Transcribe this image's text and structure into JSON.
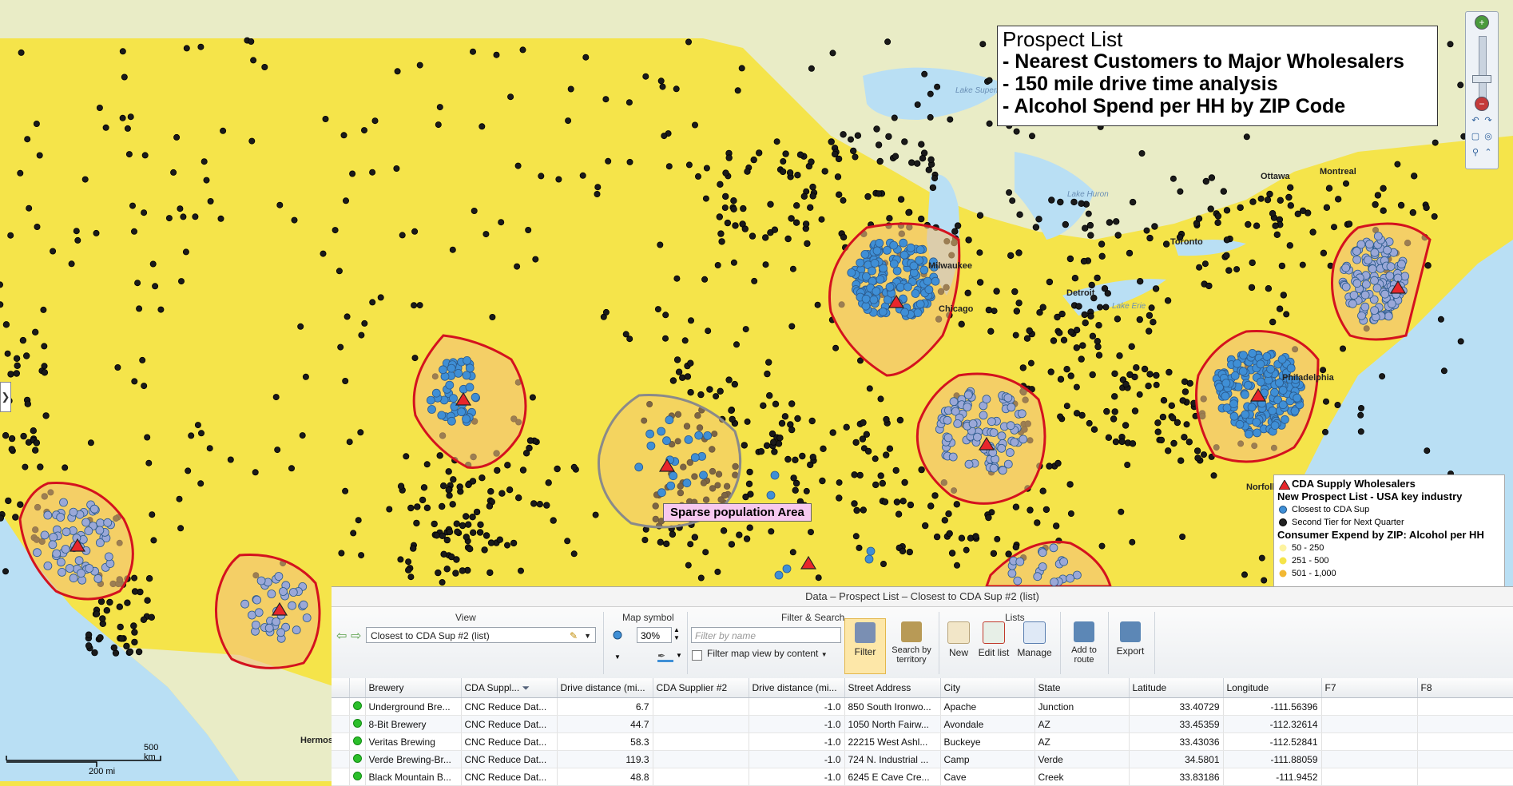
{
  "title_box": {
    "line1": "Prospect List",
    "line2": "- Nearest Customers to Major Wholesalers",
    "line3": "- 150 mile drive time analysis",
    "line4": "-  Alcohol Spend per HH by ZIP Code"
  },
  "map_labels": {
    "lake_superior": "Lake Superior",
    "lake_huron": "Lake Huron",
    "lake_erie": "Lake Erie",
    "ottawa": "Ottawa",
    "montreal": "Montreal",
    "milwaukee": "Milwaukee",
    "chicago": "Chicago",
    "detroit": "Detroit",
    "toronto": "Toronto",
    "philadelphia": "Philadelphia",
    "norfolk": "Norfolk",
    "hermosillo": "Hermos"
  },
  "callout": "Sparse population Area",
  "legend": {
    "wholesalers": "CDA Supply Wholesalers",
    "prospect_header": "New Prospect List - USA key industry",
    "closest": "Closest to CDA Sup",
    "second_tier": "Second Tier for Next Quarter",
    "consumer_header": "Consumer Expend by ZIP: Alcohol per HH",
    "range1": "50 - 250",
    "range2": "251 - 500",
    "range3": "501 - 1,000"
  },
  "scale": {
    "km": "500 km",
    "mi": "200 mi"
  },
  "panel": {
    "title": "Data – Prospect List – Closest to CDA Sup #2 (list)",
    "view_label": "View",
    "view_value": "Closest to CDA Sup #2 (list)",
    "map_symbol_label": "Map symbol",
    "percent": "30%",
    "filter_search_label": "Filter & Search",
    "filter_placeholder": "Filter by name",
    "filter_map_view": "Filter map view by content",
    "lists_label": "Lists",
    "buttons": {
      "filter": "Filter",
      "search_by_territory": "Search by territory",
      "new": "New",
      "edit_list": "Edit list",
      "manage": "Manage",
      "add_to_route": "Add to route",
      "export": "Export"
    }
  },
  "table": {
    "columns": [
      "Brewery",
      "CDA Suppl...",
      "Drive distance (mi...",
      "CDA Supplier #2",
      "Drive distance (mi...",
      "Street Address",
      "City",
      "State",
      "Latitude",
      "Longitude",
      "F7",
      "F8"
    ],
    "rows": [
      [
        "Underground Bre...",
        "CNC Reduce Dat...",
        "6.7",
        "",
        "-1.0",
        "850 South Ironwo...",
        "Apache",
        "Junction",
        "33.40729",
        "-111.56396"
      ],
      [
        "8-Bit Brewery",
        "CNC Reduce Dat...",
        "44.7",
        "",
        "-1.0",
        "1050 North Fairw...",
        "Avondale",
        "AZ",
        "33.45359",
        "-112.32614"
      ],
      [
        "Veritas Brewing",
        "CNC Reduce Dat...",
        "58.3",
        "",
        "-1.0",
        "22215 West Ashl...",
        "Buckeye",
        "AZ",
        "33.43036",
        "-112.52841"
      ],
      [
        "Verde Brewing-Br...",
        "CNC Reduce Dat...",
        "119.3",
        "",
        "-1.0",
        "724 N. Industrial ...",
        "Camp",
        "Verde",
        "34.5801",
        "-111.88059"
      ],
      [
        "Black Mountain B...",
        "CNC Reduce Dat...",
        "48.8",
        "",
        "-1.0",
        "6245 E Cave Cre...",
        "Cave",
        "Creek",
        "33.83186",
        "-111.9452"
      ]
    ]
  },
  "colors": {
    "zip_fill": "#f5e44a",
    "territory_outline": "#d4121e",
    "sparse_outline": "#8a8a8a",
    "closest_dot": "#3f8fd6",
    "second_tier_dot": "#9aa8d8",
    "prospect_dot": "#1a1a1a",
    "water": "#b9dff4",
    "land_other": "#e9ecc6"
  }
}
